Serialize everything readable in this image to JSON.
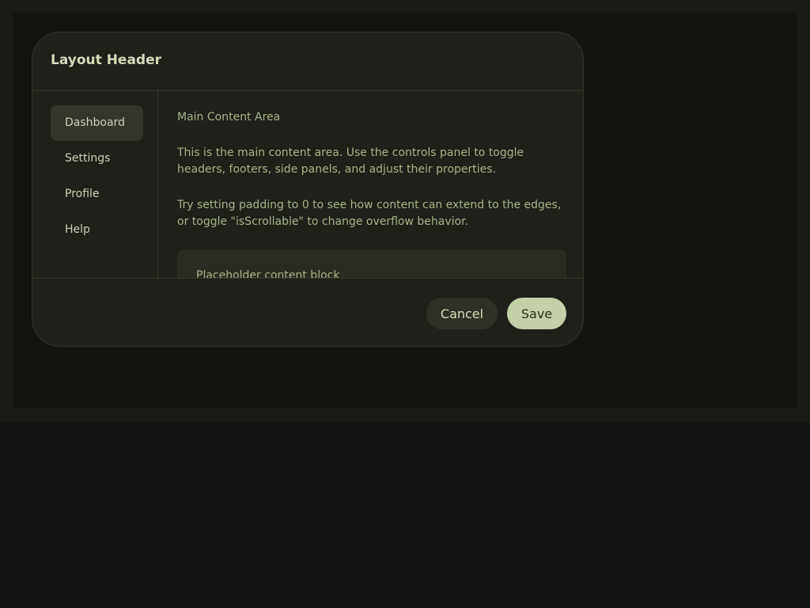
{
  "dialog": {
    "title": "Layout Header"
  },
  "sidebar": {
    "items": [
      {
        "label": "Dashboard",
        "active": true
      },
      {
        "label": "Settings",
        "active": false
      },
      {
        "label": "Profile",
        "active": false
      },
      {
        "label": "Help",
        "active": false
      }
    ]
  },
  "content": {
    "title": "Main Content Area",
    "paragraphs": [
      "This is the main content area. Use the controls panel to toggle headers, footers, side panels, and adjust their properties.",
      "Try setting padding to 0 to see how content can extend to the edges, or toggle \"isScrollable\" to change overflow behavior."
    ],
    "placeholder": "Placeholder content block"
  },
  "footer": {
    "cancel_label": "Cancel",
    "save_label": "Save"
  },
  "colors": {
    "background": "#141414",
    "dialog_background": "#1f201a",
    "accent": "#c4d1a8",
    "text_primary": "#d3dcb9",
    "text_muted": "#a5b486"
  }
}
